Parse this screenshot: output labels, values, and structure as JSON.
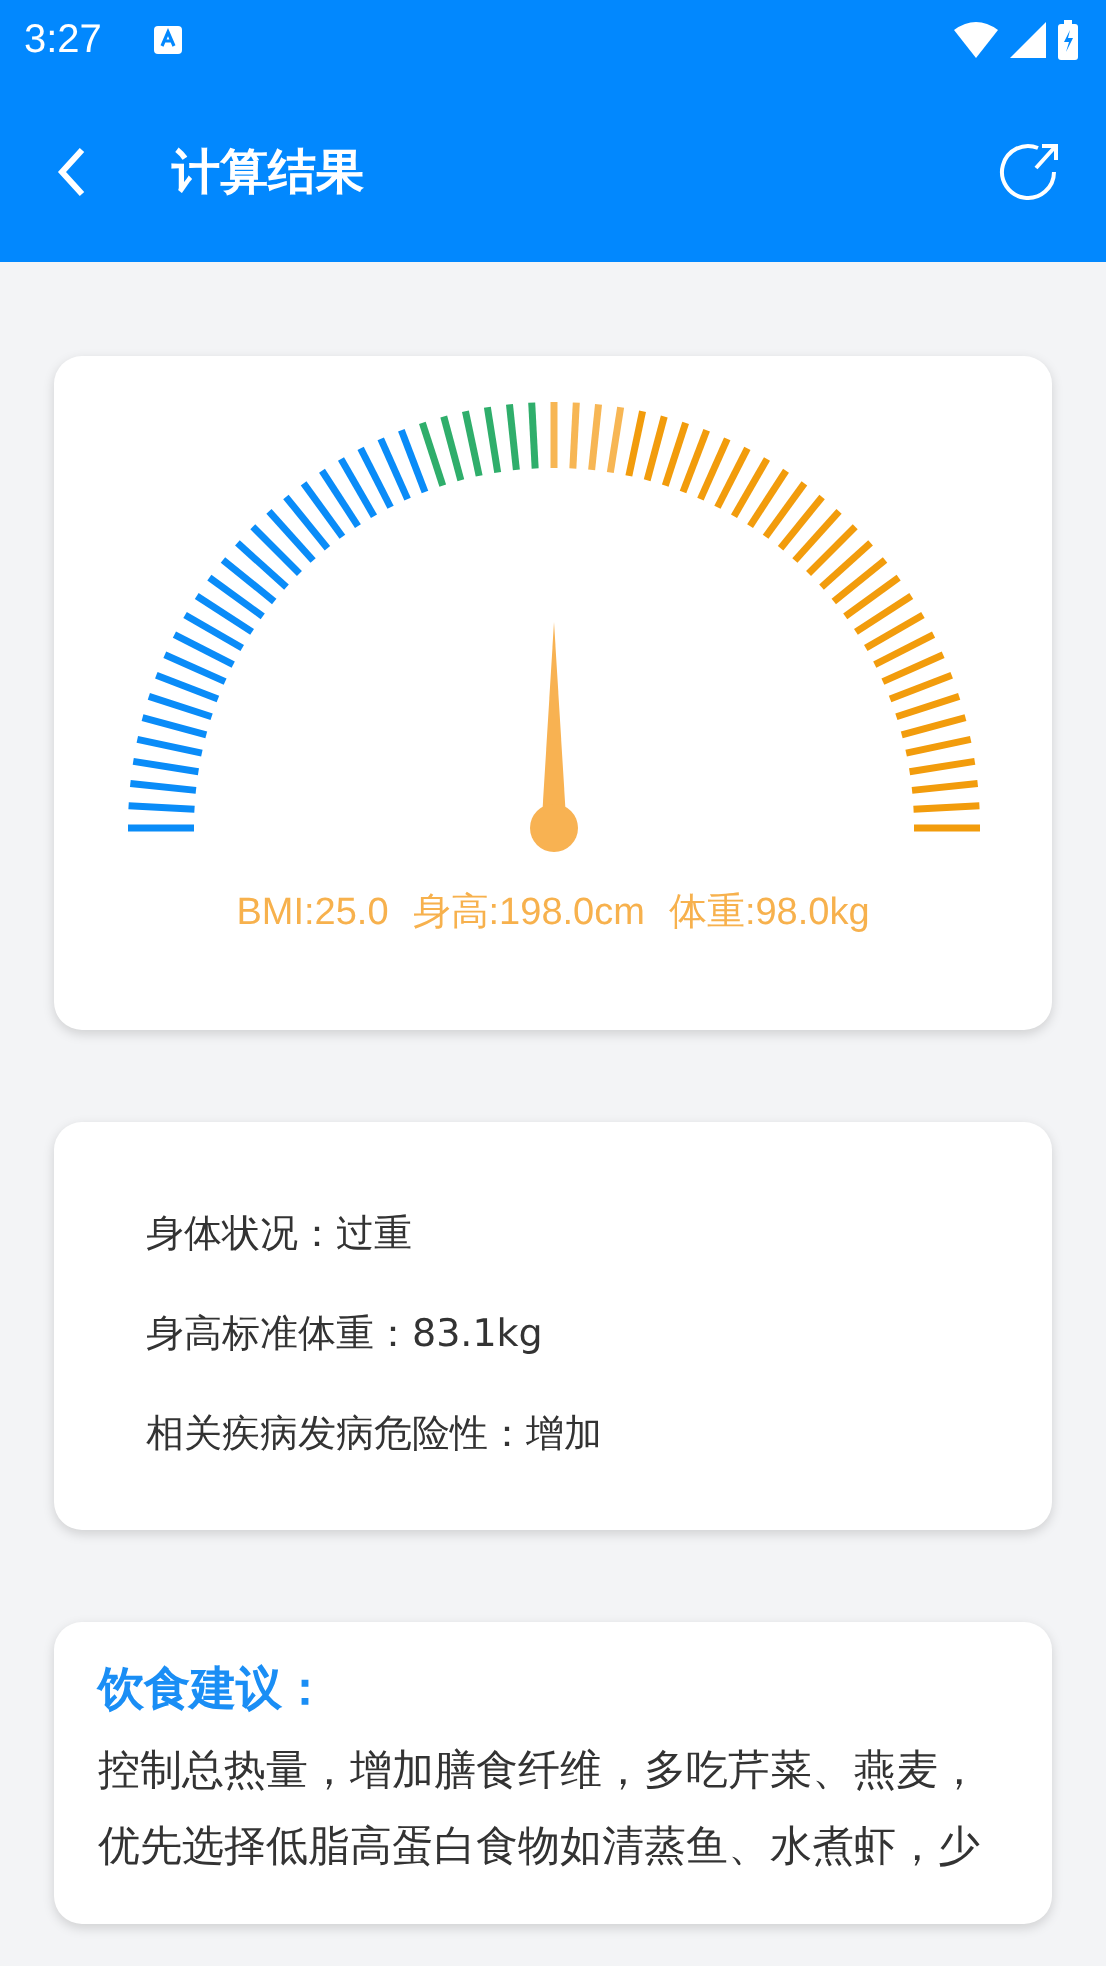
{
  "status_bar": {
    "time": "3:27"
  },
  "app_bar": {
    "title": "计算结果"
  },
  "gauge": {
    "level": 0.5,
    "readouts": [
      "BMI:25.0",
      "身高:198.0cm",
      "体重:98.0kg"
    ]
  },
  "summary": [
    "身体状况：过重",
    "身高标准体重：83.1kg",
    "相关疾病发病危险性：增加"
  ],
  "advice": {
    "title": "饮食建议：",
    "text": "控制总热量，增加膳食纤维，多吃芹菜、燕麦，优先选择低脂高蛋白食物如清蒸鱼、水煮虾，少"
  }
}
